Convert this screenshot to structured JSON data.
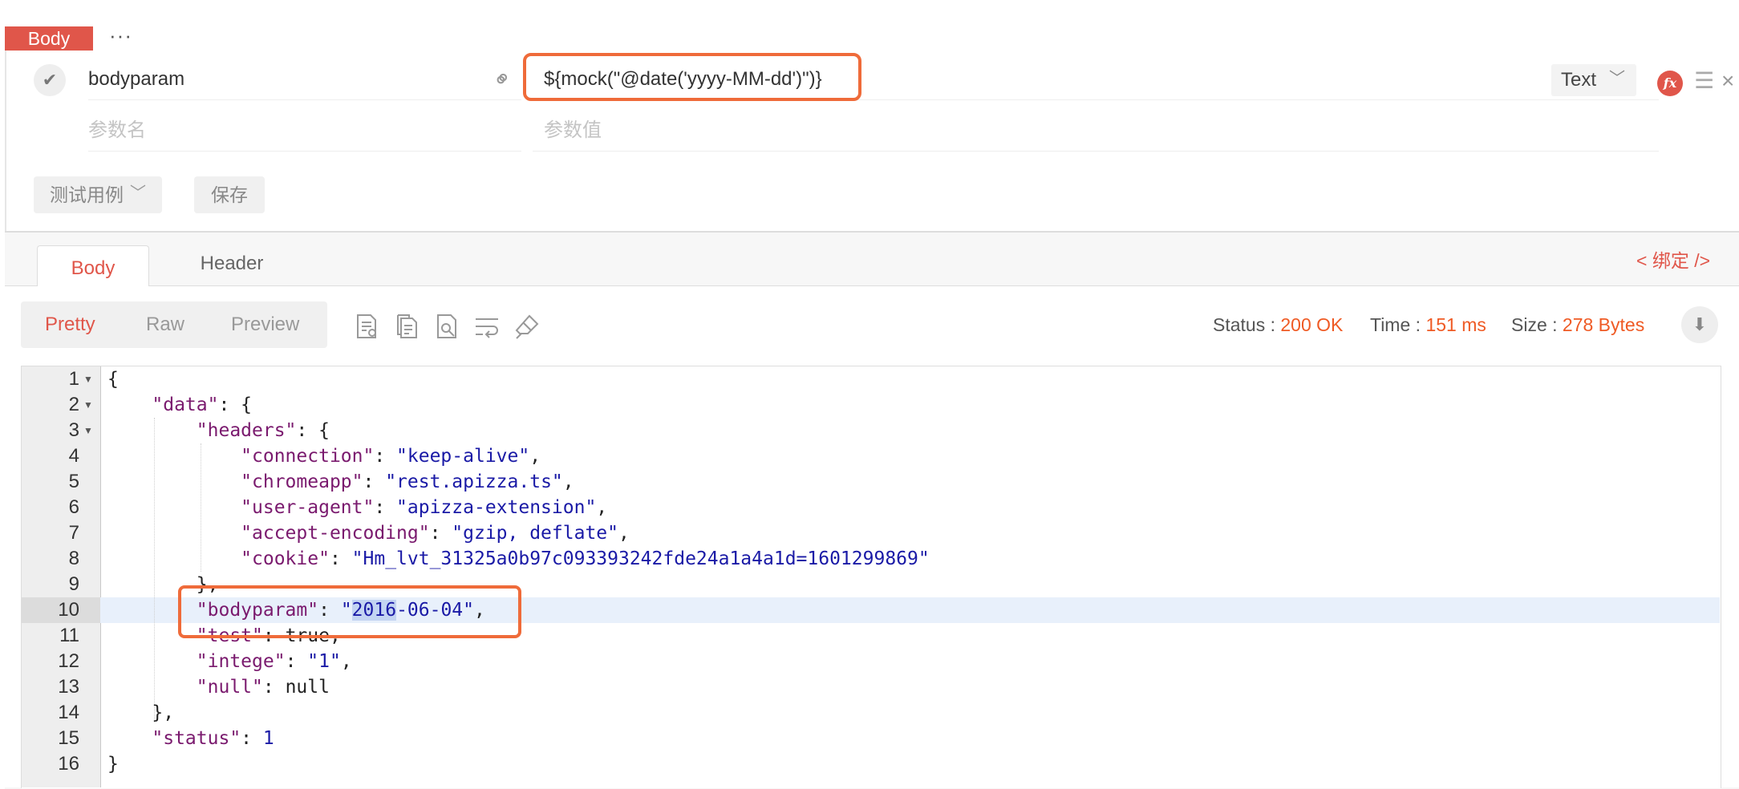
{
  "request": {
    "body_tab_label": "Body",
    "more_label": "···",
    "param": {
      "key": "bodyparam",
      "value": "${mock(\"@date('yyyy-MM-dd')\")}",
      "type": "Text"
    },
    "new_param": {
      "key_placeholder": "参数名",
      "value_placeholder": "参数值"
    },
    "testcase_label": "测试用例",
    "save_label": "保存"
  },
  "response": {
    "tabs": [
      "Body",
      "Header"
    ],
    "bind_label": "< 绑定 />",
    "view_modes": [
      "Pretty",
      "Raw",
      "Preview"
    ],
    "status_label": "Status :",
    "status_value": "200 OK",
    "time_label": "Time :",
    "time_value": "151 ms",
    "size_label": "Size :",
    "size_value": "278 Bytes",
    "tool_icons": [
      "format-icon",
      "copy-icon",
      "search-icon",
      "wrap-icon",
      "clear-icon"
    ],
    "colors": {
      "accent": "#e0564a",
      "highlight": "#ef6b3a",
      "status": "#ef5a24"
    }
  },
  "code": {
    "line_numbers": [
      "1",
      "2",
      "3",
      "4",
      "5",
      "6",
      "7",
      "8",
      "9",
      "10",
      "11",
      "12",
      "13",
      "14",
      "15",
      "16"
    ],
    "active_line": 10,
    "keys": {
      "data": "\"data\"",
      "headers": "\"headers\"",
      "connection": "\"connection\"",
      "chromeapp": "\"chromeapp\"",
      "user_agent": "\"user-agent\"",
      "accept_encoding": "\"accept-encoding\"",
      "cookie": "\"cookie\"",
      "bodyparam": "\"bodyparam\"",
      "test": "\"test\"",
      "intege": "\"intege\"",
      "null": "\"null\"",
      "status": "\"status\""
    },
    "values": {
      "connection": "\"keep-alive\"",
      "chromeapp": "\"rest.apizza.ts\"",
      "user_agent": "\"apizza-extension\"",
      "accept_encoding": "\"gzip, deflate\"",
      "cookie": "\"Hm_lvt_31325a0b97c093393242fde24a1a4a1d=1601299869\"",
      "bodyparam_q1": "\"",
      "bodyparam_sel": "2016",
      "bodyparam_rest": "-06-04\"",
      "test": "true",
      "intege": "\"1\"",
      "null": "null",
      "status": "1"
    }
  }
}
